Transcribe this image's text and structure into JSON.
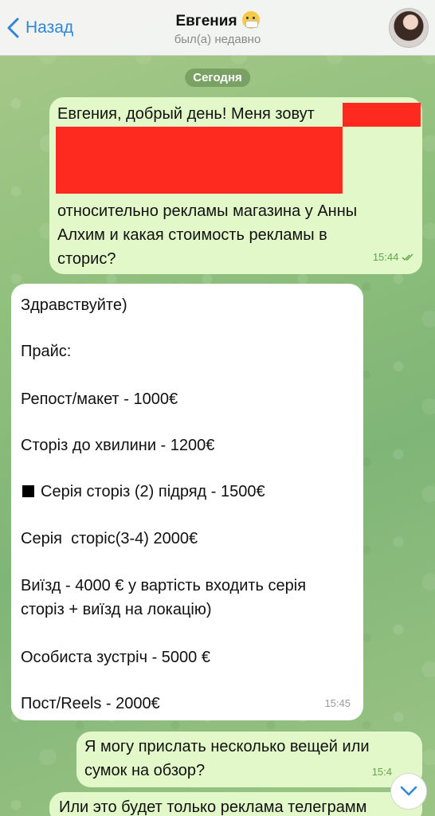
{
  "header": {
    "back_label": "Назад",
    "title": "Евгения",
    "status": "был(а) недавно"
  },
  "date_chip": "Сегодня",
  "messages": [
    {
      "direction": "out",
      "lines": [
        "Евгения, добрый день! Меня зовут",
        "относительно рекламы магазина у Анны",
        "Алхим и какая стоимость рекламы в",
        "сторис?"
      ],
      "time": "15:44"
    },
    {
      "direction": "in",
      "lines": [
        "Здравствуйте)",
        "Прайс:",
        "Репост/макет - 1000€",
        "Сторіз до хвилини - 1200€",
        "Серія сторіз (2) підряд - 1500€",
        "Серія  сторіс(3-4) 2000€",
        "Виїзд - 4000 € у вартість входить серія",
        "сторіз + виїзд на локацію)",
        "Особиста зустріч - 5000 €",
        "Пост/Reels - 2000€"
      ],
      "time": "15:45"
    },
    {
      "direction": "out",
      "lines": [
        "Я могу прислать несколько вещей или",
        "сумок на обзор?"
      ],
      "time": "15:4"
    },
    {
      "direction": "out",
      "lines": [
        "Или это будет только реклама телеграмм"
      ],
      "time": ""
    }
  ],
  "colors": {
    "accent": "#2f86d9",
    "outgoing_bubble": "#e2f8c8",
    "incoming_bubble": "#ffffff",
    "redaction": "#ff2a1f",
    "read_time": "#5fa64f"
  },
  "icons": {
    "back": "chevron-left-icon",
    "scroll": "chevron-down-icon",
    "read": "double-check-icon"
  }
}
